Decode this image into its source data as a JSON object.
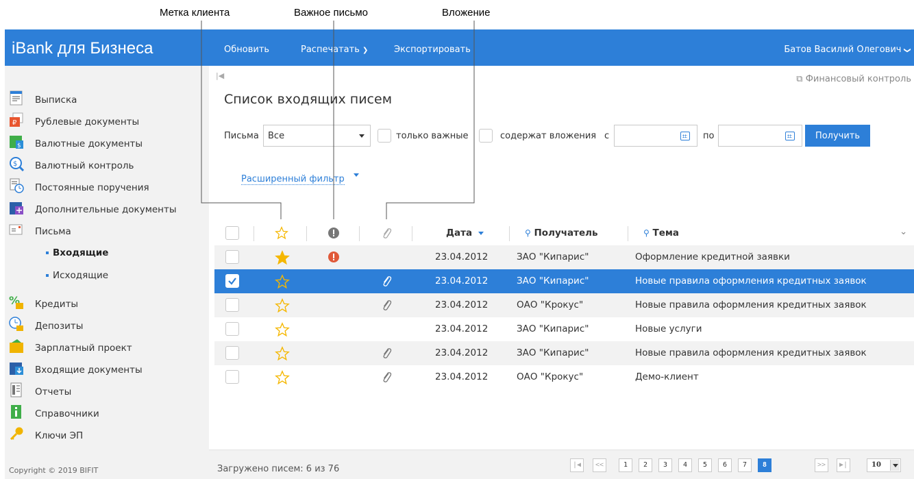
{
  "callouts": {
    "client_mark": "Метка клиента",
    "important": "Важное письмо",
    "attachment": "Вложение"
  },
  "header": {
    "brand": "iBank для Бизнеса",
    "refresh": "Обновить",
    "print": "Распечатать",
    "export": "Экспортировать",
    "user": "Батов Василий Олегович"
  },
  "sidebar": {
    "items": [
      {
        "label": "Выписка",
        "icon": "statement-icon"
      },
      {
        "label": "Рублевые документы",
        "icon": "ruble-docs-icon"
      },
      {
        "label": "Валютные документы",
        "icon": "currency-docs-icon"
      },
      {
        "label": "Валютный контроль",
        "icon": "currency-control-icon"
      },
      {
        "label": "Постоянные поручения",
        "icon": "standing-orders-icon"
      },
      {
        "label": "Дополнительные документы",
        "icon": "additional-docs-icon"
      },
      {
        "label": "Письма",
        "icon": "letters-icon"
      }
    ],
    "sub_items": [
      {
        "label": "Входящие",
        "active": true
      },
      {
        "label": "Исходящие",
        "active": false
      }
    ],
    "items2": [
      {
        "label": "Кредиты",
        "icon": "credits-icon"
      },
      {
        "label": "Депозиты",
        "icon": "deposits-icon"
      },
      {
        "label": "Зарплатный проект",
        "icon": "salary-project-icon"
      },
      {
        "label": "Входящие документы",
        "icon": "incoming-docs-icon"
      },
      {
        "label": "Отчеты",
        "icon": "reports-icon"
      },
      {
        "label": "Справочники",
        "icon": "directories-icon"
      },
      {
        "label": "Ключи ЭП",
        "icon": "keys-icon"
      }
    ],
    "copyright": "Copyright © 2019 BIFIT"
  },
  "main": {
    "fin_control": "Финансовый контроль",
    "title": "Список входящих писем",
    "filters": {
      "letters_label": "Письма",
      "letters_value": "Все",
      "only_important": "только важные",
      "has_attachments": "содержат вложения",
      "from_label": "с",
      "to_label": "по",
      "get_button": "Получить"
    },
    "advanced_filter": "Расширенный фильтр",
    "columns": {
      "date": "Дата",
      "recipient": "Получатель",
      "subject": "Тема"
    },
    "rows": [
      {
        "checked": false,
        "starred": true,
        "important": true,
        "attachment": false,
        "date": "23.04.2012",
        "recipient": "ЗАО \"Кипарис\"",
        "subject": "Оформление кредитной заявки"
      },
      {
        "checked": true,
        "starred": false,
        "important": false,
        "attachment": true,
        "date": "23.04.2012",
        "recipient": "ЗАО \"Кипарис\"",
        "subject": "Новые правила оформления кредитных заявок"
      },
      {
        "checked": false,
        "starred": false,
        "important": false,
        "attachment": true,
        "date": "23.04.2012",
        "recipient": "ОАО \"Крокус\"",
        "subject": "Новые правила оформления кредитных заявок"
      },
      {
        "checked": false,
        "starred": false,
        "important": false,
        "attachment": false,
        "date": "23.04.2012",
        "recipient": "ЗАО \"Кипарис\"",
        "subject": "Новые услуги"
      },
      {
        "checked": false,
        "starred": false,
        "important": false,
        "attachment": true,
        "date": "23.04.2012",
        "recipient": "ЗАО \"Кипарис\"",
        "subject": "Новые правила оформления кредитных заявок"
      },
      {
        "checked": false,
        "starred": false,
        "important": false,
        "attachment": true,
        "date": "23.04.2012",
        "recipient": "ОАО \"Крокус\"",
        "subject": "Демо-клиент"
      }
    ],
    "footer": {
      "loaded": "Загружено писем: 6 из 76",
      "pages": [
        "1",
        "2",
        "3",
        "4",
        "5",
        "6",
        "7",
        "8"
      ],
      "current_page": "8",
      "page_size": "10"
    }
  },
  "colors": {
    "accent": "#2d7fd8",
    "star": "#f5b700",
    "important": "#e05a3a"
  }
}
